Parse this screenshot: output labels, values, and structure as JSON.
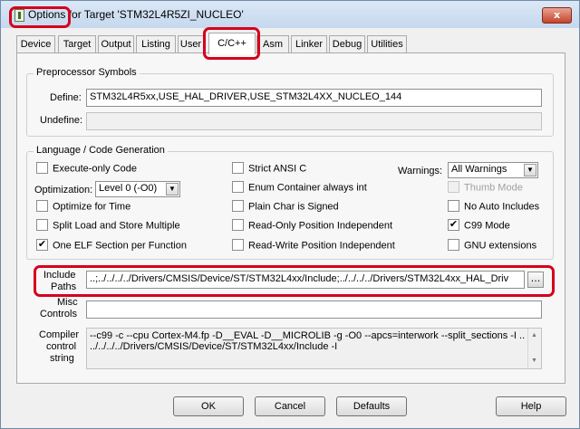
{
  "window": {
    "title": "Options for Target 'STM32L4R5ZI_NUCLEO'",
    "close_label": "x"
  },
  "tabs": [
    {
      "label": "Device"
    },
    {
      "label": "Target"
    },
    {
      "label": "Output"
    },
    {
      "label": "Listing"
    },
    {
      "label": "User"
    },
    {
      "label": "C/C++",
      "active": true
    },
    {
      "label": "Asm"
    },
    {
      "label": "Linker"
    },
    {
      "label": "Debug"
    },
    {
      "label": "Utilities"
    }
  ],
  "preprocessor": {
    "title": "Preprocessor Symbols",
    "define_label": "Define:",
    "define_value": "STM32L4R5xx,USE_HAL_DRIVER,USE_STM32L4XX_NUCLEO_144",
    "undefine_label": "Undefine:",
    "undefine_value": ""
  },
  "language": {
    "title": "Language / Code Generation",
    "checkboxes": {
      "execute_only": {
        "label": "Execute-only Code",
        "checked": false
      },
      "optimize_time": {
        "label": "Optimize for Time",
        "checked": false
      },
      "split_load": {
        "label": "Split Load and Store Multiple",
        "checked": false
      },
      "one_elf": {
        "label": "One ELF Section per Function",
        "checked": true
      },
      "strict_ansi": {
        "label": "Strict ANSI C",
        "checked": false
      },
      "enum_container": {
        "label": "Enum Container always int",
        "checked": false
      },
      "plain_char": {
        "label": "Plain Char is Signed",
        "checked": false
      },
      "ro_pi": {
        "label": "Read-Only Position Independent",
        "checked": false
      },
      "rw_pi": {
        "label": "Read-Write Position Independent",
        "checked": false
      },
      "thumb_mode": {
        "label": "Thumb Mode",
        "checked": false,
        "disabled": true
      },
      "no_auto_includes": {
        "label": "No Auto Includes",
        "checked": false
      },
      "c99_mode": {
        "label": "C99 Mode",
        "checked": true
      },
      "gnu_extensions": {
        "label": "GNU extensions",
        "checked": false
      }
    },
    "optimization_label": "Optimization:",
    "optimization_value": "Level 0 (-O0)",
    "warnings_label": "Warnings:",
    "warnings_value": "All Warnings"
  },
  "paths": {
    "include_label_line1": "Include",
    "include_label_line2": "Paths",
    "include_value": "..;../../../../Drivers/CMSIS/Device/ST/STM32L4xx/Include;../../../../Drivers/STM32L4xx_HAL_Driv",
    "browse_label": "...",
    "misc_label_line1": "Misc",
    "misc_label_line2": "Controls",
    "misc_value": ""
  },
  "compiler": {
    "label_line1": "Compiler",
    "label_line2": "control",
    "label_line3": "string",
    "line1": "--c99 -c --cpu Cortex-M4.fp -D__EVAL -D__MICROLIB -g -O0 --apcs=interwork --split_sections -I .. -I",
    "line2": "../../../../Drivers/CMSIS/Device/ST/STM32L4xx/Include -I"
  },
  "buttons": {
    "ok": "OK",
    "cancel": "Cancel",
    "defaults": "Defaults",
    "help": "Help"
  }
}
